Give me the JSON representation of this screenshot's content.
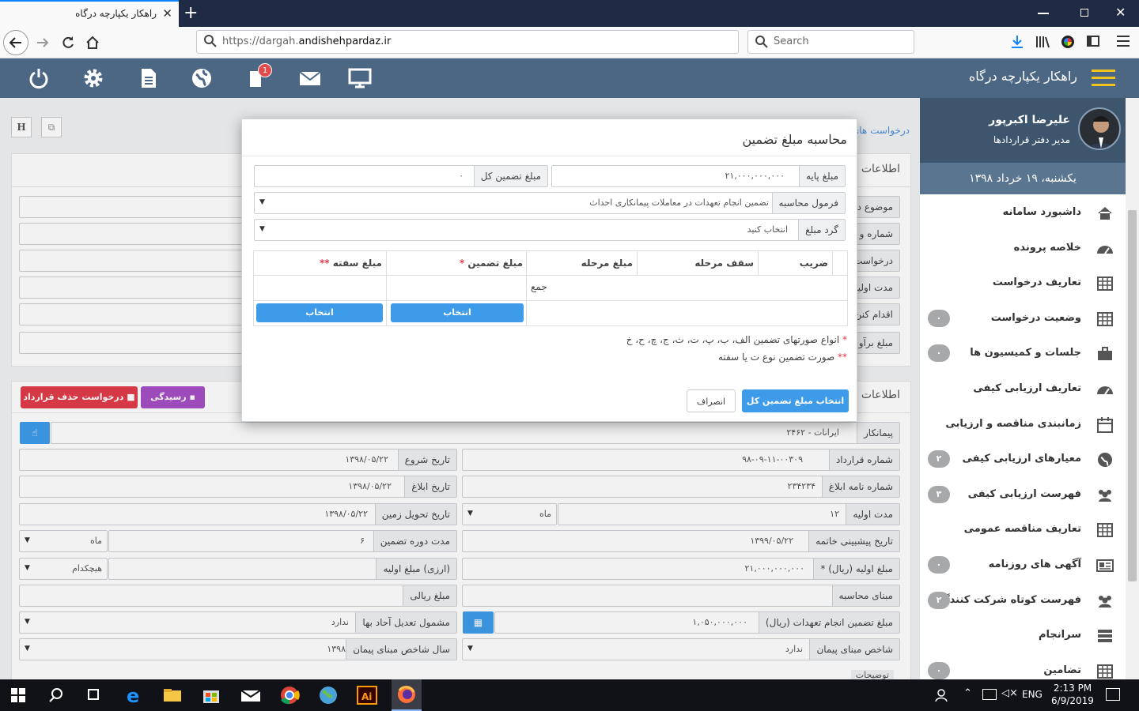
{
  "browser": {
    "tab_title": "راهکار یکپارچه درگاه",
    "url_prefix": "https://dargah.",
    "url_domain": "andishehpardaz.ir",
    "search_placeholder": "Search"
  },
  "app": {
    "brand": "راهکار یکپارچه درگاه",
    "notification_count": "1"
  },
  "user": {
    "name": "علیرضا اکبرپور",
    "role": "مدیر دفتر قراردادها",
    "date": "یکشنبه، ۱۹ خرداد ۱۳۹۸"
  },
  "sidebar": {
    "items": [
      {
        "label": "داشبورد سامانه",
        "icon": "home-icon",
        "badge": ""
      },
      {
        "label": "خلاصه پرونده",
        "icon": "dashboard-icon",
        "badge": ""
      },
      {
        "label": "تعاریف درخواست",
        "icon": "table-icon",
        "badge": ""
      },
      {
        "label": "وضعیت درخواست",
        "icon": "table-icon",
        "badge": "۰"
      },
      {
        "label": "جلسات و کمیسیون ها",
        "icon": "briefcase-icon",
        "badge": "۰"
      },
      {
        "label": "تعاریف ارزیابی کیفی",
        "icon": "dashboard-icon",
        "badge": ""
      },
      {
        "label": "زمانبندی مناقصه و ارزیابی",
        "icon": "calendar-icon",
        "badge": ""
      },
      {
        "label": "معیارهای ارزیابی کیفی",
        "icon": "globe-icon",
        "badge": "۲"
      },
      {
        "label": "فهرست ارزیابی کیفی",
        "icon": "users-icon",
        "badge": "۳"
      },
      {
        "label": "تعاریف مناقصه عمومی",
        "icon": "table-icon",
        "badge": ""
      },
      {
        "label": "آگهی های روزنامه",
        "icon": "newspaper-icon",
        "badge": "۰"
      },
      {
        "label": "فهرست کوتاه شرکت کنندگان",
        "icon": "users-icon",
        "badge": "۲"
      },
      {
        "label": "سرانجام",
        "icon": "server-icon",
        "badge": ""
      },
      {
        "label": "تضامین",
        "icon": "table-icon",
        "badge": "۰"
      }
    ]
  },
  "main": {
    "breadcrumb": "درخواست های",
    "toolbar_h": "H",
    "section1_title": "اطلاعات",
    "section1_labels": [
      "موضوع د",
      "شماره و ت",
      "درخواست",
      "مدت اولیه",
      "اقدام کنن",
      "مبلغ برآو"
    ],
    "section2_title": "اطلاعات",
    "delete_button": "درخواست حذف قرارداد",
    "review_button": "رسیدگی",
    "fields": {
      "contractor_label": "پیمانکار",
      "contractor_value": "ایرانات - ۲۴۶۲",
      "contract_no_label": "شماره قرارداد",
      "contract_no_value": "۹۸-۰۹-۱۱-۰۰۳۰۹",
      "start_label": "تاریخ شروع",
      "start_value": "۱۳۹۸/۰۵/۲۲",
      "letter_no_label": "شماره نامه ابلاغ",
      "letter_no_value": "۲۳۴۲۳۴",
      "notify_label": "تاریخ ابلاغ",
      "notify_value": "۱۳۹۸/۰۵/۲۲",
      "initial_dur_label": "مدت اولیه",
      "initial_dur_value": "۱۲",
      "initial_dur_unit": "ماه",
      "delivery_label": "تاریخ تحویل زمین",
      "delivery_value": "۱۳۹۸/۰۵/۲۲",
      "end_label": "تاریخ پیشبینی خاتمه",
      "end_value": "۱۳۹۹/۰۵/۲۲",
      "warranty_label": "مدت دوره تضمین",
      "warranty_value": "۶",
      "warranty_unit": "ماه",
      "amount_rial_label": "مبلغ اولیه (ریال) *",
      "amount_rial_value": "۲۱,۰۰۰,۰۰۰,۰۰۰",
      "amount_fx_label": "(ارزی) مبلغ اولیه",
      "amount_fx_value": "هیچکدام",
      "calc_base_label": "مبنای محاسبه",
      "rial_amount_label": "مبلغ ریالی",
      "guarantee_label": "مبلغ تضمین انجام تعهدات (ریال)",
      "guarantee_value": "۱,۰۵۰,۰۰۰,۰۰۰",
      "price_adj_label": "مشمول تعدیل آحاد بها",
      "price_adj_value": "ندارد",
      "index_label": "شاخص مبنای پیمان",
      "index_value": "ندارد",
      "index_year_label": "سال شاخص مبنای پیمان",
      "index_year_value": "۱۳۹۸",
      "notes_label": "توضیحات"
    }
  },
  "modal": {
    "title": "محاسبه مبلغ تضمین",
    "base_amount_label": "مبلغ پایه",
    "base_amount_value": "۲۱,۰۰۰,۰۰۰,۰۰۰",
    "total_label": "مبلغ تضمین کل",
    "total_value": "۰",
    "formula_label": "فرمول محاسبه",
    "formula_value": "تضمین انجام تعهدات در معاملات پیمانکاری احداث",
    "rounding_label": "گرد مبلغ",
    "rounding_value": "انتخاب کنید",
    "table_headers": [
      "ضریب",
      "سقف مرحله",
      "مبلغ مرحله",
      "مبلغ تضمین *",
      "مبلغ سفته **"
    ],
    "sum_label": "جمع",
    "select_label": "انتخاب",
    "note1": "انواع صورتهای تضمین الف، ب، پ، ت، ث، ج، چ، ح، خ",
    "note1_mark": "*",
    "note2": "صورت تضمین نوع ت یا سفته",
    "note2_mark": "**",
    "confirm_button": "انتخاب مبلغ تضمین کل",
    "cancel_button": "انصراف"
  },
  "taskbar": {
    "time": "2:13 PM",
    "date": "6/9/2019",
    "lang": "ENG"
  }
}
